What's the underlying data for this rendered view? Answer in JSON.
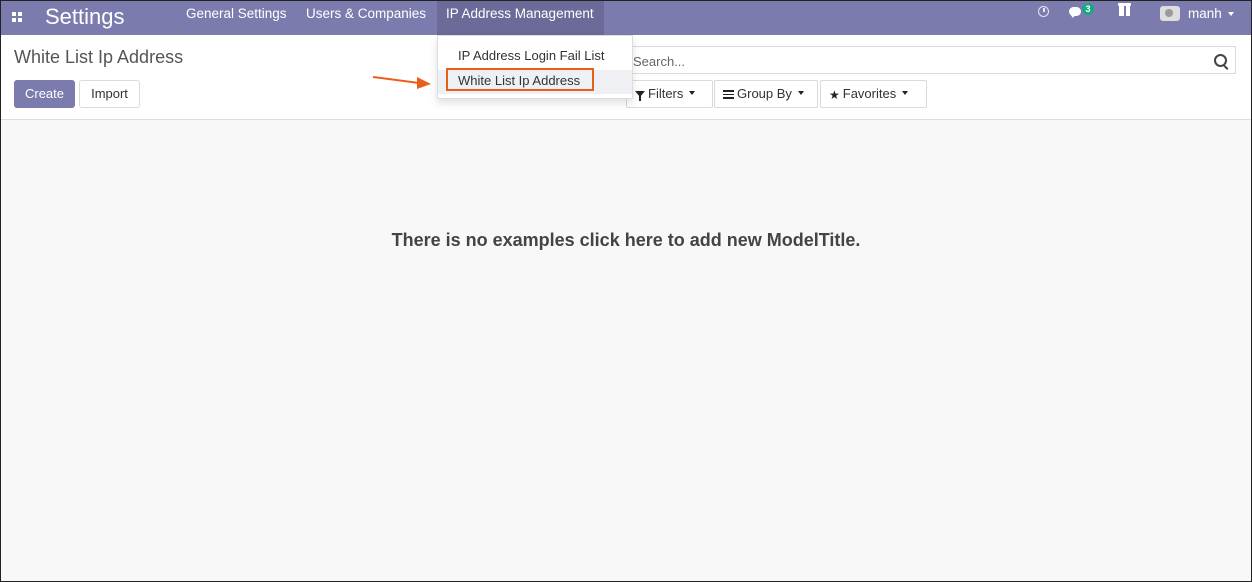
{
  "navbar": {
    "app_name": "Settings",
    "menus": [
      {
        "label": "General Settings"
      },
      {
        "label": "Users & Companies"
      },
      {
        "label": "IP Address Management"
      }
    ],
    "chat_badge": "3",
    "user_name": "manh",
    "colors": {
      "bar": "#7c7bad",
      "active": "#6b6a99",
      "badge": "#1aa883"
    },
    "icons": [
      "apps-icon",
      "clock-icon",
      "chat-icon",
      "gift-icon",
      "avatar",
      "caret-down-icon"
    ]
  },
  "dropdown": {
    "items": [
      {
        "label": "IP Address Login Fail List"
      },
      {
        "label": "White List Ip Address"
      }
    ],
    "highlight_color": "#e85f1c"
  },
  "control_panel": {
    "breadcrumb": "White List Ip Address",
    "create_label": "Create",
    "import_label": "Import",
    "search_placeholder": "Search...",
    "filters_label": "Filters",
    "group_by_label": "Group By",
    "favorites_label": "Favorites"
  },
  "content": {
    "empty_message": "There is no examples click here to add new ModelTitle."
  }
}
